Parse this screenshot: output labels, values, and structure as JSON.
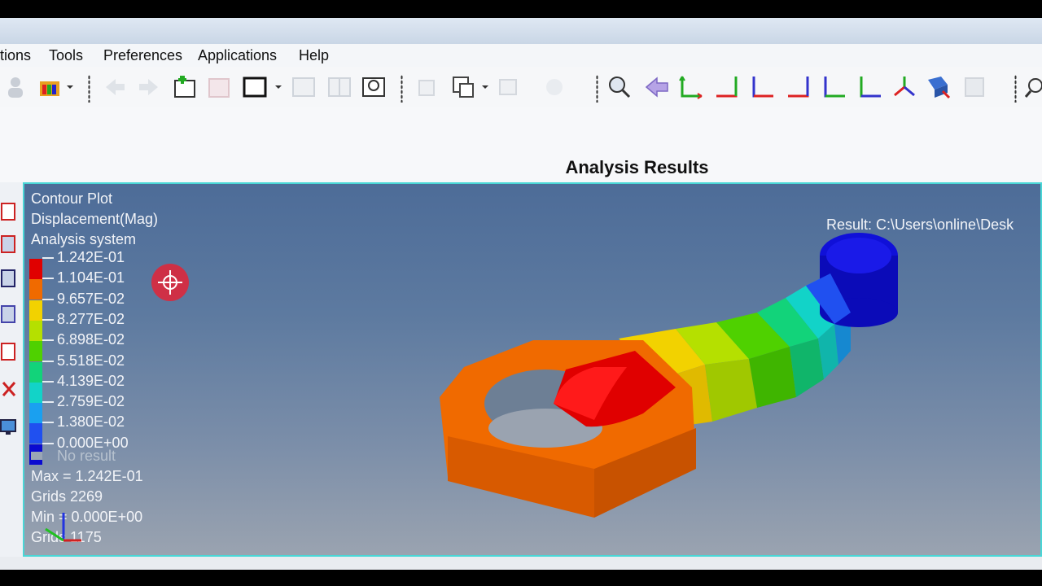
{
  "menu": {
    "items": [
      "tions",
      "Tools",
      "Preferences",
      "Applications",
      "Help"
    ]
  },
  "panel": {
    "title": "Analysis Results"
  },
  "viewport": {
    "plot_type": "Contour Plot",
    "result_type": "Displacement(Mag)",
    "system": "Analysis system",
    "result_path": "Result: C:\\Users\\online\\Desk",
    "legend": [
      {
        "value": "1.242E-01",
        "color": "#e00000"
      },
      {
        "value": "1.104E-01",
        "color": "#f06a00"
      },
      {
        "value": "9.657E-02",
        "color": "#f2d200"
      },
      {
        "value": "8.277E-02",
        "color": "#b5e000"
      },
      {
        "value": "6.898E-02",
        "color": "#4fd100"
      },
      {
        "value": "5.518E-02",
        "color": "#12d37a"
      },
      {
        "value": "4.139E-02",
        "color": "#12d3c8"
      },
      {
        "value": "2.759E-02",
        "color": "#1aa0f0"
      },
      {
        "value": "1.380E-02",
        "color": "#2050f0"
      },
      {
        "value": "0.000E+00",
        "color": "#0a0ad0"
      }
    ],
    "no_result": "No result",
    "max_line": "Max = 1.242E-01",
    "max_grids": "Grids 2269",
    "min_line": "Min = 0.000E+00",
    "min_grids": "Grids 1175"
  },
  "toolbar_icons": [
    "user-icon",
    "palette-icon",
    "back-icon",
    "forward-icon",
    "add-icon",
    "copy-icon",
    "window-icon",
    "split-icon",
    "split2-icon",
    "zoom-window-icon",
    "paste-icon",
    "paste2-icon",
    "copy2-icon",
    "copy3-icon",
    "zoom-icon",
    "back-arrow-icon",
    "view-xy-icon",
    "view-yx-icon",
    "view-zx-icon",
    "view-xz-icon",
    "view-zy-icon",
    "view-yz-icon",
    "view-iso-icon",
    "view-3d-icon",
    "save-view-icon",
    "search-icon"
  ]
}
